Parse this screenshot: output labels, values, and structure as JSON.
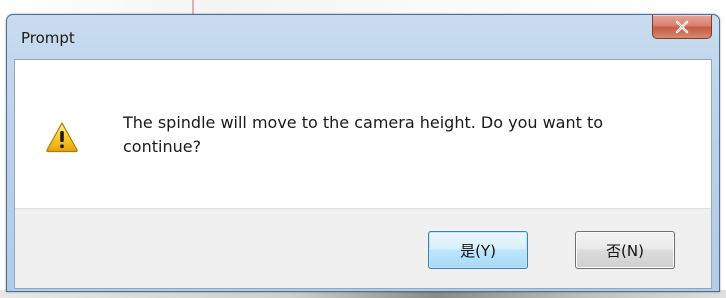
{
  "dialog": {
    "title": "Prompt",
    "message": "The spindle will move to the camera height. Do you want to continue?",
    "icon": "warning-icon",
    "buttons": {
      "yes_label": "是(Y)",
      "no_label": "否(N)"
    }
  },
  "colors": {
    "title_bar": "#bcd2ea",
    "close_button": "#d9826f",
    "default_button_border": "#3c7fb1",
    "button_area": "#f0f0f0"
  }
}
